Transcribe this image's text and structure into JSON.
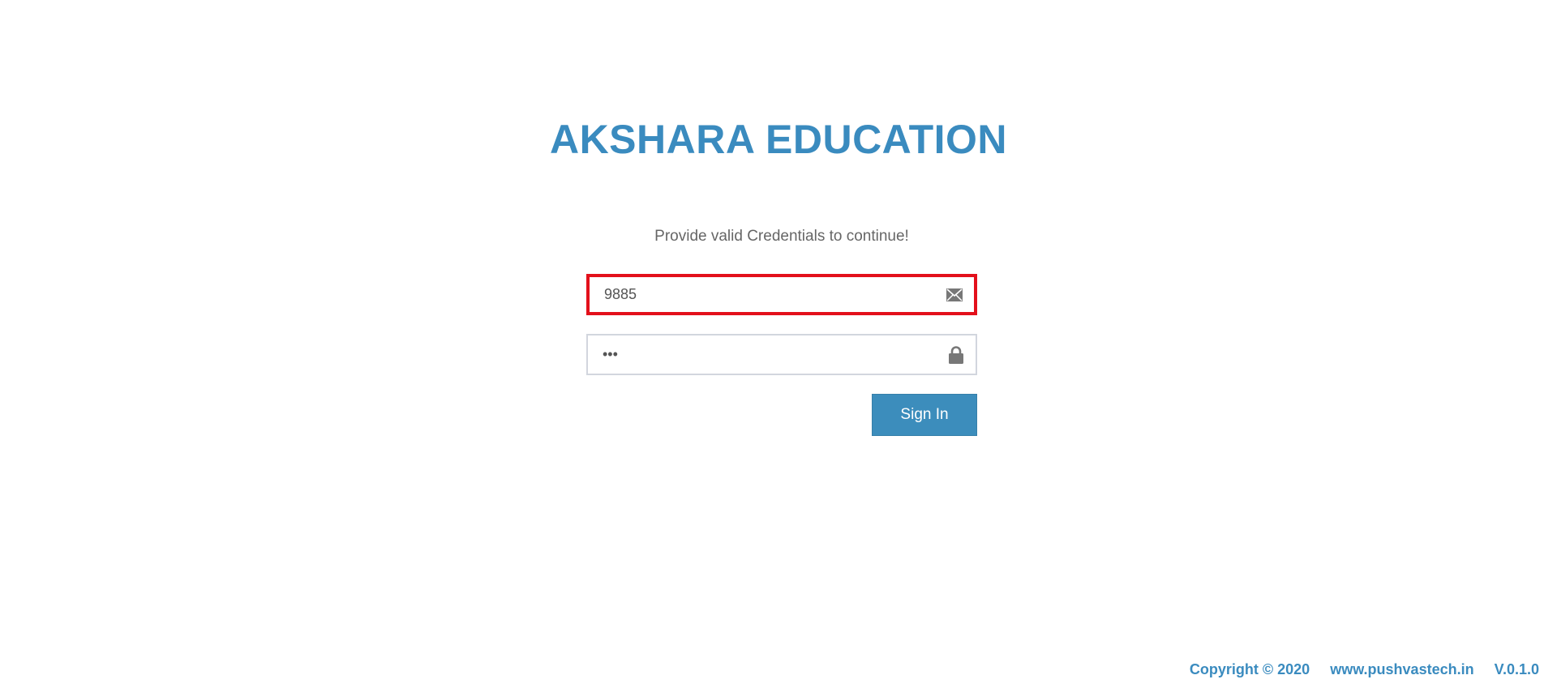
{
  "brand": {
    "title": "AKSHARA EDUCATION"
  },
  "login": {
    "message": "Provide valid Credentials to continue!",
    "email_field": {
      "value": "9885",
      "icon": "envelope-icon"
    },
    "password_field": {
      "value": "•••",
      "icon": "lock-icon"
    },
    "signin_label": "Sign In"
  },
  "footer": {
    "copyright": "Copyright © 2020",
    "website": "www.pushvastech.in",
    "version": "V.0.1.0"
  },
  "colors": {
    "brand": "#3a8bbf",
    "button": "#3c8dbc",
    "focus_border": "#e3101b",
    "icon": "#777777"
  }
}
